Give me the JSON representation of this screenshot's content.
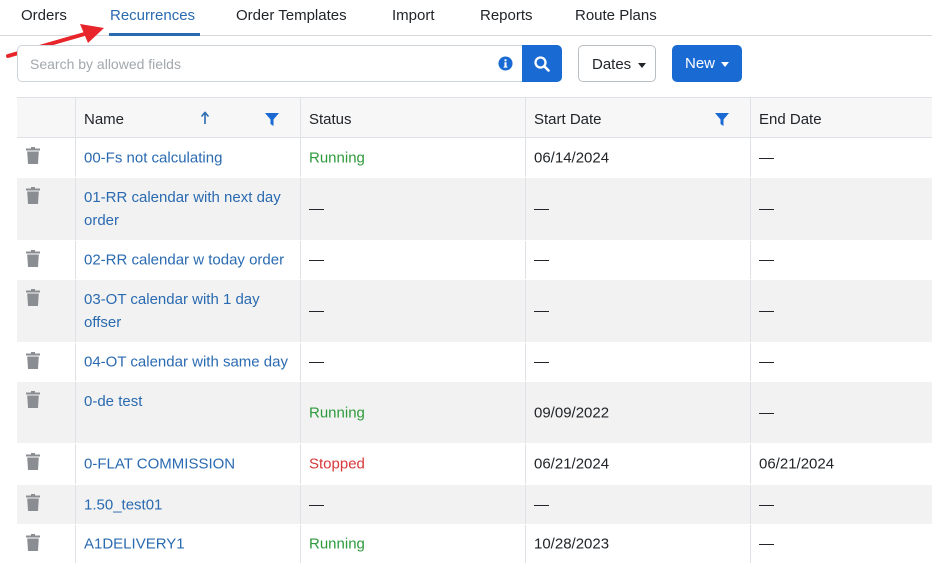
{
  "tabs": [
    {
      "label": "Orders",
      "active": false
    },
    {
      "label": "Recurrences",
      "active": true
    },
    {
      "label": "Order Templates",
      "active": false
    },
    {
      "label": "Import",
      "active": false
    },
    {
      "label": "Reports",
      "active": false
    },
    {
      "label": "Route Plans",
      "active": false
    }
  ],
  "toolbar": {
    "search_placeholder": "Search by allowed fields",
    "search_value": "",
    "dates_label": "Dates",
    "new_label": "New"
  },
  "table": {
    "columns": [
      "Name",
      "Status",
      "Start Date",
      "End Date"
    ],
    "sorted_column": "Name",
    "sort_direction": "ascending",
    "filtered_columns": [
      "Name",
      "Start Date"
    ],
    "rows": [
      {
        "name": "00-Fs not calculating",
        "status": "Running",
        "start": "06/14/2024",
        "end": "—"
      },
      {
        "name": "01-RR calendar with next day order",
        "status": "—",
        "start": "—",
        "end": "—"
      },
      {
        "name": "02-RR calendar w today order",
        "status": "—",
        "start": "—",
        "end": "—"
      },
      {
        "name": "03-OT calendar with 1 day offser",
        "status": "—",
        "start": "—",
        "end": "—"
      },
      {
        "name": "04-OT calendar with same day",
        "status": "—",
        "start": "—",
        "end": "—"
      },
      {
        "name": "0-de test",
        "status": "Running",
        "start": "09/09/2022",
        "end": "—"
      },
      {
        "name": "0-FLAT COMMISSION",
        "status": "Stopped",
        "start": "06/21/2024",
        "end": "06/21/2024"
      },
      {
        "name": "1.50_test01",
        "status": "—",
        "start": "—",
        "end": "—"
      },
      {
        "name": "A1DELIVERY1",
        "status": "Running",
        "start": "10/28/2023",
        "end": "—"
      }
    ]
  },
  "colors": {
    "accent": "#1a6ad3",
    "link": "#2a6ab1",
    "running": "#2e9a3c",
    "stopped": "#d9383a",
    "annotation_arrow": "#e8252a"
  },
  "icons": [
    "info-icon",
    "search-icon",
    "sort-ascending-icon",
    "filter-icon",
    "trash-icon",
    "arrow-annotation"
  ]
}
